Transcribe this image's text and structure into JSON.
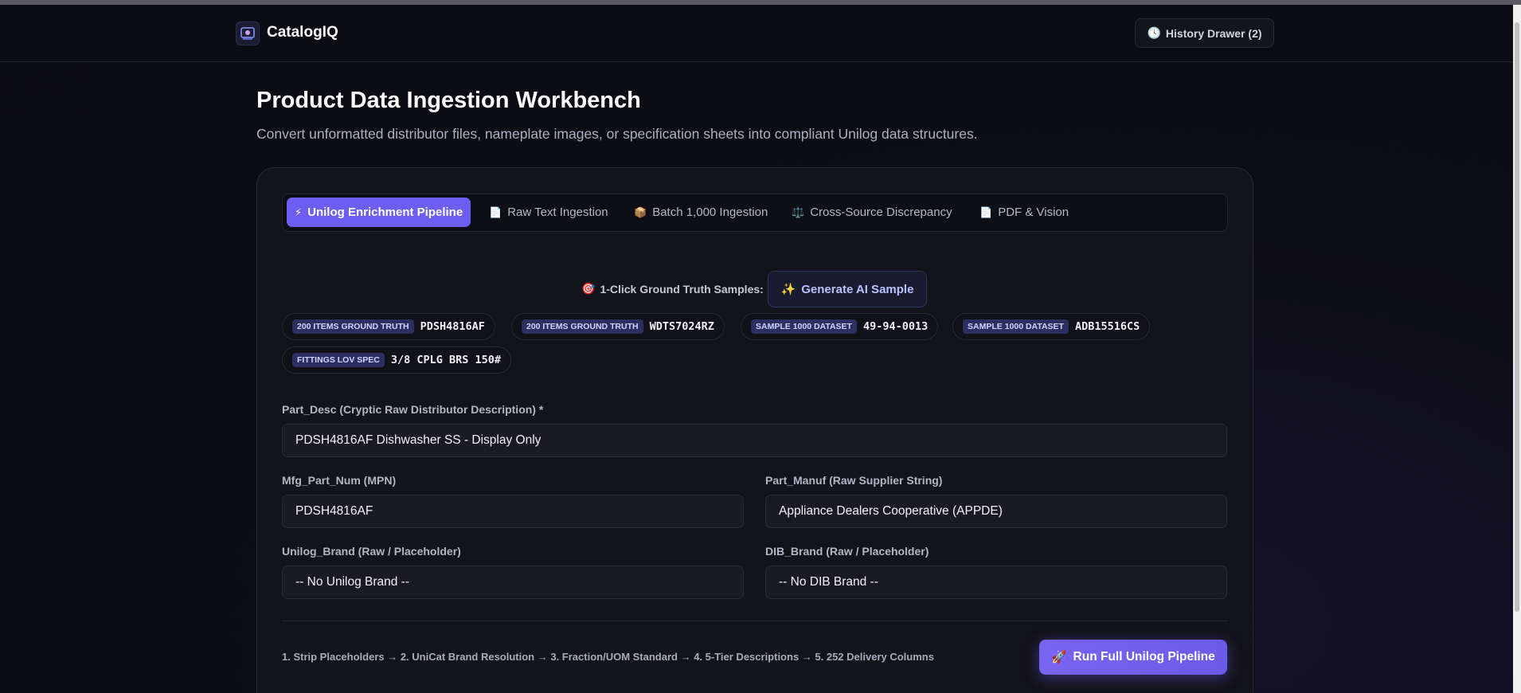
{
  "header": {
    "app_name": "CatalogIQ",
    "history_button": "History Drawer (2)"
  },
  "page": {
    "title": "Product Data Ingestion Workbench",
    "subtitle": "Convert unformatted distributor files, nameplate images, or specification sheets into compliant Unilog data structures."
  },
  "tabs": [
    {
      "label": "Unilog Enrichment Pipeline",
      "icon": "⚡",
      "active": true
    },
    {
      "label": "Raw Text Ingestion",
      "icon": "📄",
      "active": false
    },
    {
      "label": "Batch 1,000 Ingestion",
      "icon": "📦",
      "active": false
    },
    {
      "label": "Cross-Source Discrepancy",
      "icon": "⚖️",
      "active": false
    },
    {
      "label": "PDF & Vision",
      "icon": "📄",
      "active": false
    }
  ],
  "samples": {
    "label": "1-Click Ground Truth Samples:",
    "label_icon": "🎯",
    "generate_button": "Generate AI Sample",
    "generate_icon": "✨",
    "chips": [
      {
        "tag": "200 ITEMS GROUND TRUTH",
        "code": "PDSH4816AF"
      },
      {
        "tag": "200 ITEMS GROUND TRUTH",
        "code": "WDTS7024RZ"
      },
      {
        "tag": "SAMPLE 1000 DATASET",
        "code": "49-94-0013"
      },
      {
        "tag": "SAMPLE 1000 DATASET",
        "code": "ADB15516CS"
      },
      {
        "tag": "FITTINGS LOV SPEC",
        "code": "3/8 CPLG BRS 150#"
      }
    ]
  },
  "form": {
    "part_desc": {
      "label": "Part_Desc (Cryptic Raw Distributor Description) *",
      "value": "PDSH4816AF Dishwasher SS - Display Only"
    },
    "mfg_part_num": {
      "label": "Mfg_Part_Num (MPN)",
      "value": "PDSH4816AF"
    },
    "part_manuf": {
      "label": "Part_Manuf (Raw Supplier String)",
      "value": "Appliance Dealers Cooperative (APPDE)"
    },
    "unilog_brand": {
      "label": "Unilog_Brand (Raw / Placeholder)",
      "value": "-- No Unilog Brand --"
    },
    "dib_brand": {
      "label": "DIB_Brand (Raw / Placeholder)",
      "value": "-- No DIB Brand --"
    }
  },
  "footer": {
    "pipeline_steps": "1. Strip Placeholders → 2. UniCat Brand Resolution → 3. Fraction/UOM Standard → 4. 5-Tier Descriptions → 5. 252 Delivery Columns",
    "run_button": "Run Full Unilog Pipeline",
    "run_icon": "🚀"
  },
  "colors": {
    "accent": "#6b5ef0",
    "background": "#0c0c13",
    "card": "#13131b"
  }
}
